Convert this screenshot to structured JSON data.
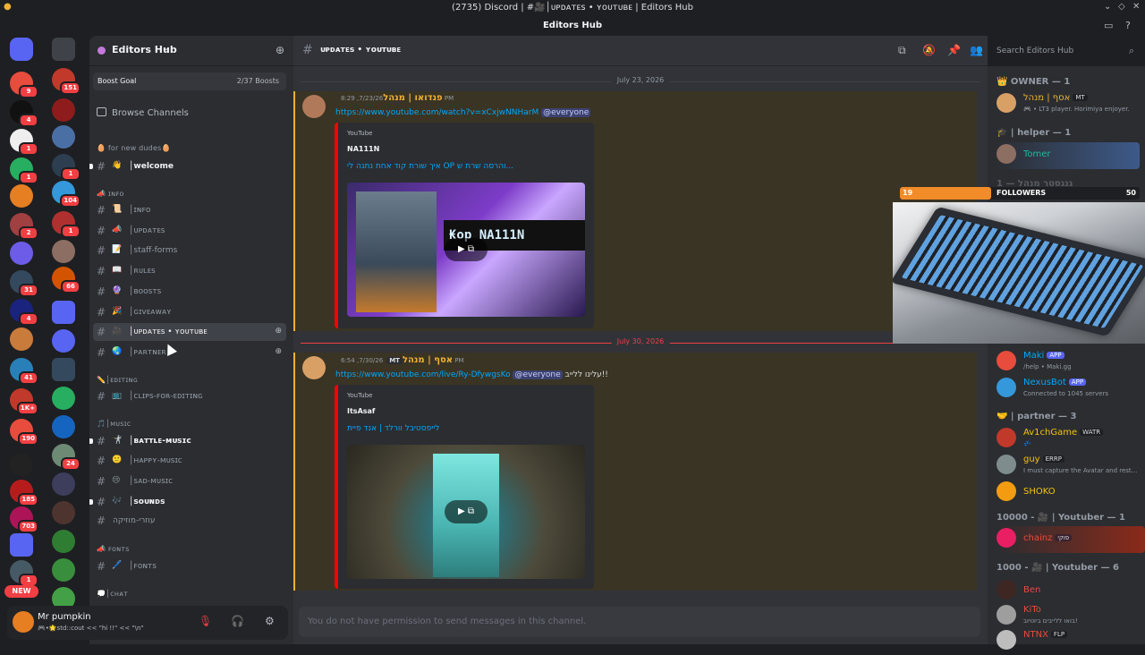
{
  "window": {
    "title": "(2735) Discord | #🎥│ᴜᴘᴅᴀᴛᴇs • ʏᴏᴜᴛᴜʙᴇ | Editors Hub",
    "server_title": "Editors Hub"
  },
  "rail": {
    "badges": [
      "151",
      "9",
      "4",
      "1",
      "1",
      "1",
      "104",
      "2",
      "1",
      "66",
      "31",
      "4",
      "41",
      "1K+",
      "190",
      "24",
      "185",
      "703",
      "1"
    ],
    "new_label": "NEW"
  },
  "sidebar": {
    "server_name": "Editors Hub",
    "boost_label": "Boost Goal",
    "boost_progress": "2/37 Boosts",
    "browse": "Browse Channels",
    "categories": {
      "newdudes": "🥚 for new dudes🥚",
      "info": "📣 ɪɴꜰᴏ",
      "editing": "✏️│ᴇᴅɪᴛɪɴɢ",
      "music": "🎵│ᴍᴜsɪᴄ",
      "fonts": "📣 ꜰᴏɴᴛs",
      "chat": "💭│ᴄʜᴀᴛ"
    },
    "channels": [
      {
        "emoji": "👋",
        "label": "│welcome"
      },
      {
        "emoji": "📜",
        "label": "│ɪɴꜰᴏ"
      },
      {
        "emoji": "📣",
        "label": "│ᴜᴘᴅᴀᴛᴇs"
      },
      {
        "emoji": "📝",
        "label": "│staff-forms"
      },
      {
        "emoji": "📖",
        "label": "│ʀᴜʟᴇs"
      },
      {
        "emoji": "🔮",
        "label": "│ʙᴏᴏsᴛs"
      },
      {
        "emoji": "🎉",
        "label": "│ɢɪᴠᴇᴀᴡᴀʏ"
      },
      {
        "emoji": "🎥",
        "label": "│ᴜᴘᴅᴀᴛᴇs • ʏᴏᴜᴛᴜʙᴇ"
      },
      {
        "emoji": "🌏",
        "label": "│ᴘᴀʀᴛɴᴇʀ"
      },
      {
        "emoji": "📺",
        "label": "│ᴄʟɪᴘs-ꜰᴏʀ-ᴇᴅɪᴛɪɴɢ"
      },
      {
        "emoji": "🤺",
        "label": "│ʙᴀᴛᴛʟᴇ-ᴍᴜsɪᴄ"
      },
      {
        "emoji": "🙂",
        "label": "│ʜᴀᴘᴘʏ-ᴍᴜsɪᴄ"
      },
      {
        "emoji": "😢",
        "label": "│sᴀᴅ-ᴍᴜsɪᴄ"
      },
      {
        "emoji": "🎶",
        "label": "│sᴏᴜɴᴅs"
      },
      {
        "emoji": "",
        "label": "עוזרי-מוזיקה"
      },
      {
        "emoji": "🖊️",
        "label": "│ꜰᴏɴᴛs"
      }
    ]
  },
  "user": {
    "name": "Mr pumpkin",
    "status": "🎮•🌟std::cout << \"hi !!\" << \"\\n\""
  },
  "channel_header": {
    "name": "ᴜᴘᴅᴀᴛᴇs • ʏᴏᴜᴛᴜʙᴇ",
    "search_placeholder": "Search Editors Hub"
  },
  "messages": {
    "date1": "July 23, 2026",
    "date2": "July 30, 2026",
    "m1": {
      "author": "פנדואו | מנהל",
      "time": "7/23/26, 8:29 PM",
      "link": "https://www.youtube.com/watch?v=xCxjwNNHarM",
      "mention": "@everyone",
      "embed_provider": "YouTube",
      "embed_author": "NA111N",
      "embed_title": "איך שורת קוד אחת נתנה לי OP והרסה שרת ש...",
      "thumb_text": "₭op NA111N"
    },
    "m2": {
      "author": "אסף | מנהל",
      "tag": "MT",
      "time": "7/30/26, 6:54 PM",
      "link": "https://www.youtube.com/live/Ry-DfywgsKo",
      "mention": "@everyone",
      "text": "עלינו ללייב!!",
      "embed_provider": "YouTube",
      "embed_author": "ItsAsaf",
      "embed_title": "לייפסטיבל וורלד | אנד פיית"
    },
    "composer": "You do not have permission to send messages in this channel."
  },
  "members": {
    "owner_group": "👑 OWNER — 1",
    "owner_name": "אסף | מנהל",
    "owner_tag": "MT",
    "owner_sub": "🎮 • LT3 player. Horimiya enjoyer.",
    "helper_group": "🎓 | helper — 1",
    "helper_name": "Tomer",
    "hidden_group": "גנגסטר מנהל — 1",
    "maki_name": "Maki",
    "maki_tag": "APP",
    "maki_sub": "/help • Maki.gg",
    "nexus_name": "NexusBot",
    "nexus_tag": "APP",
    "nexus_sub": "Connected to 1045 servers",
    "partner_group": "🤝 | partner — 3",
    "p1_name": "Av1chGame",
    "p1_tag": "WATR",
    "p1_sub": "💤",
    "p2_name": "guy",
    "p2_tag": "ERRP",
    "p2_sub": "I must capture the Avatar and rest...",
    "p3_name": "SHOKO",
    "yt10k_group": "10000 - 🎥 | Youtuber — 1",
    "yt10k_name": "chainz",
    "yt10k_tag": "פוקי",
    "yt1k_group": "1000 - 🎥 | Youtuber — 6",
    "y1_name": "Ben",
    "y2_name": "KiTo",
    "y2_sub": "בואו ללייבים ביוטיוב!",
    "y3_name": "NTNX",
    "y3_tag": "FLP"
  },
  "overlay": {
    "current": "19",
    "label": "FOLLOWERS",
    "goal": "50",
    "progress_fraction": 0.38
  },
  "colors": {
    "brand": "#5865f2",
    "gold_role": "#f0b232",
    "teal_role": "#1abc9c",
    "partner_role": "#f1c40f",
    "youtuber_role": "#e74c3c",
    "mention_bg": "#3c4270",
    "link": "#00a8fc"
  }
}
